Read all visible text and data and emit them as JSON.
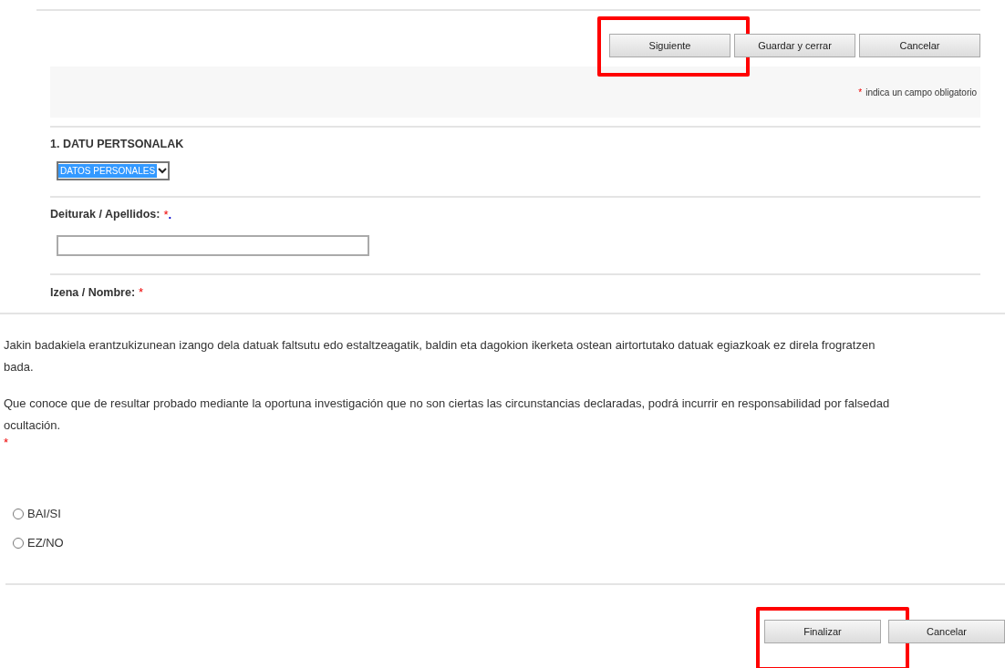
{
  "top_buttons": [
    {
      "label": "Siguiente",
      "highlighted": true
    },
    {
      "label": "Guardar y cerrar",
      "highlighted": false
    },
    {
      "label": "Cancelar",
      "highlighted": false
    }
  ],
  "required_note": {
    "mark": "*",
    "text": "indica un campo obligatorio"
  },
  "section": {
    "title": "1. DATU PERTSONALAK",
    "select_value": "DATOS PERSONALES"
  },
  "fields": [
    {
      "kind": "text_input",
      "label": "Deiturak / Apellidos:",
      "required_mark": "*",
      "extra_mark": "."
    },
    {
      "kind": "label_only",
      "label": "Izena / Nombre:",
      "required_mark": "*"
    }
  ],
  "declaration": {
    "paragraphs": [
      [
        "Jakin badakiela erantzukizunean izango dela datuak faltsutu edo estaltzeagatik, baldin eta dagokion ikerketa ostean airtortutako datuak egiazkoak ez direla frogratzen",
        "bada."
      ],
      [
        "Que conoce que de resultar probado mediante la oportuna investigación que no son ciertas las circunstancias declaradas, podrá incurrir en responsabilidad por falsedad",
        "ocultación."
      ]
    ],
    "required_mark": "*"
  },
  "options": [
    {
      "label": "BAI/SI",
      "selected": false
    },
    {
      "label": "EZ/NO",
      "selected": false
    }
  ],
  "bottom_buttons": [
    {
      "label": "Finalizar",
      "highlighted": true
    },
    {
      "label": "Cancelar",
      "highlighted": false
    }
  ]
}
